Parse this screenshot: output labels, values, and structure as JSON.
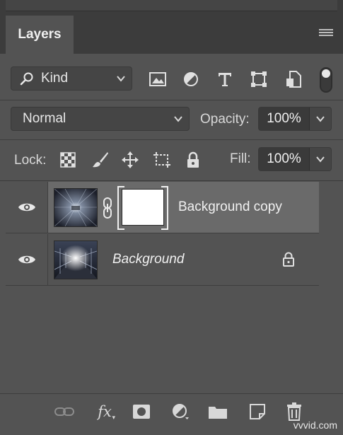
{
  "panel": {
    "tab_label": "Layers"
  },
  "filter": {
    "kind_label": "Kind"
  },
  "blend": {
    "mode": "Normal",
    "opacity_label": "Opacity:",
    "opacity_value": "100%"
  },
  "lock": {
    "label": "Lock:",
    "fill_label": "Fill:",
    "fill_value": "100%"
  },
  "layers": [
    {
      "name": "Background copy",
      "selected": true,
      "visible": true,
      "has_mask": true
    },
    {
      "name": "Background",
      "selected": false,
      "visible": true,
      "locked": true
    }
  ],
  "footer_icons": [
    "link-icon",
    "fx-icon",
    "add-mask-icon",
    "adjustment-icon",
    "folder-icon",
    "new-layer-icon",
    "trash-icon"
  ],
  "watermark": "vvvid.com"
}
